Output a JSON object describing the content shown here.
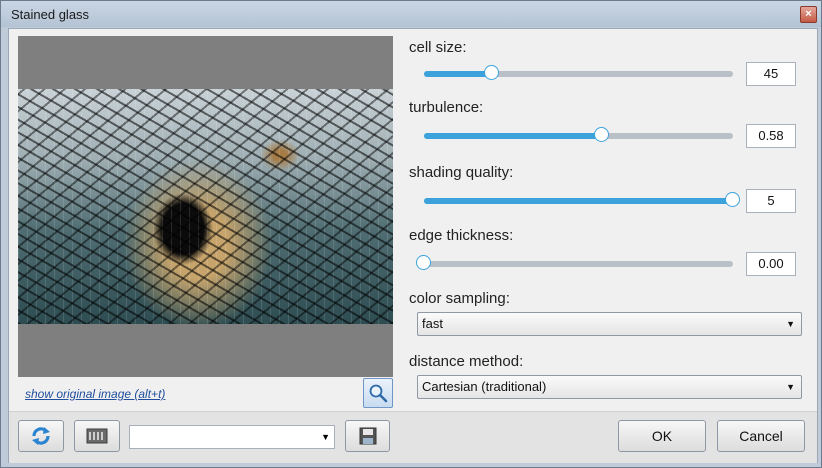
{
  "window": {
    "title": "Stained glass",
    "close_glyph": "×"
  },
  "preview": {
    "show_original_link": "show original image (alt+t)",
    "zoom_icon": "magnifier-icon"
  },
  "settings": {
    "cell_size": {
      "label": "cell size:",
      "value": "45",
      "fraction": 0.22
    },
    "turbulence": {
      "label": "turbulence:",
      "value": "0.58",
      "fraction": 0.575
    },
    "shading_quality": {
      "label": "shading quality:",
      "value": "5",
      "fraction": 1.0
    },
    "edge_thickness": {
      "label": "edge thickness:",
      "value": "0.00",
      "fraction": 0.0
    },
    "color_sampling": {
      "label": "color sampling:",
      "selected": "fast"
    },
    "distance_method": {
      "label": "distance method:",
      "selected": "Cartesian (traditional)"
    }
  },
  "footer": {
    "refresh_icon": "refresh-icon",
    "randomize_icon": "randomize-icon",
    "save_icon": "save-preset-icon",
    "preset_value": "",
    "ok_label": "OK",
    "cancel_label": "Cancel"
  },
  "colors": {
    "accent": "#3ba2dc",
    "track": "#b9c0c8"
  }
}
